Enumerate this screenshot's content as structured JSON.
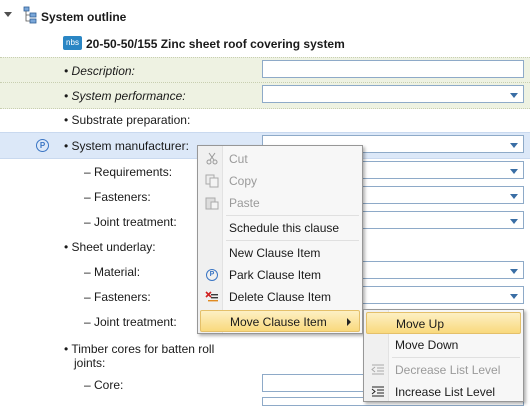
{
  "header": {
    "title": "System outline"
  },
  "clause": {
    "badge": "nbs",
    "title": "20-50-50/155  Zinc sheet roof covering system"
  },
  "rows": [
    {
      "label": "• Description:"
    },
    {
      "label": "• System performance:"
    },
    {
      "label": "• Substrate preparation:"
    },
    {
      "label": "• System manufacturer:",
      "icon": "P"
    },
    {
      "label": "– Requirements:"
    },
    {
      "label": "– Fasteners:"
    },
    {
      "label": "– Joint treatment:"
    },
    {
      "label": "• Sheet underlay:"
    },
    {
      "label": "– Material:"
    },
    {
      "label": "– Fasteners:"
    },
    {
      "label": "– Joint treatment:"
    },
    {
      "label": "• Timber cores for batten roll"
    },
    {
      "label": "joints:"
    },
    {
      "label": "– Core:"
    }
  ],
  "context_menu": {
    "items": [
      {
        "label": "Cut",
        "icon": "scissors-icon"
      },
      {
        "label": "Copy",
        "icon": "copy-icon"
      },
      {
        "label": "Paste",
        "icon": "paste-icon"
      },
      {
        "label": "Schedule this clause"
      },
      {
        "label": "New Clause Item"
      },
      {
        "label": "Park Clause Item",
        "icon": "park-icon"
      },
      {
        "label": "Delete Clause Item",
        "icon": "delete-icon"
      },
      {
        "label": "Move Clause Item",
        "icon": "submenu-arrow-icon"
      }
    ]
  },
  "submenu": {
    "items": [
      {
        "label": "Move Up"
      },
      {
        "label": "Move Down"
      },
      {
        "label": "Decrease List Level",
        "icon": "decrease-indent-icon"
      },
      {
        "label": "Increase List Level",
        "icon": "increase-indent-icon"
      }
    ]
  },
  "colors": {
    "accent": "#3a6ea5",
    "highlight": "#fbe6a5",
    "badge": "#2a86c4"
  }
}
